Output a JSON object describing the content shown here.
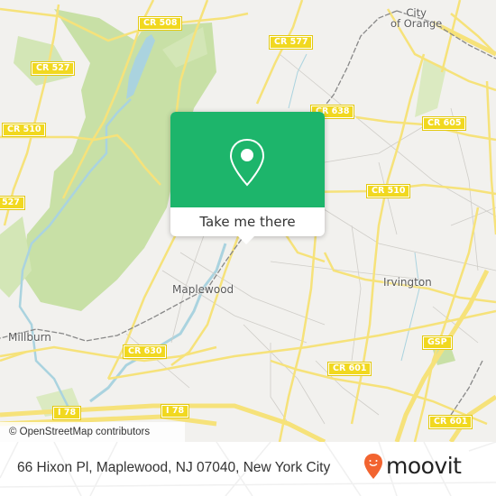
{
  "map": {
    "road_labels": [
      {
        "id": "cr508",
        "text": "CR 508"
      },
      {
        "id": "cr527a",
        "text": "CR 527"
      },
      {
        "id": "cr510a",
        "text": "CR 510"
      },
      {
        "id": "cr527b",
        "text": "527"
      },
      {
        "id": "cr577",
        "text": "CR 577"
      },
      {
        "id": "cr638",
        "text": "CR 638"
      },
      {
        "id": "cr605",
        "text": "CR 605"
      },
      {
        "id": "cr510b",
        "text": "CR 510"
      },
      {
        "id": "cr630",
        "text": "CR 630"
      },
      {
        "id": "i78a",
        "text": "I 78"
      },
      {
        "id": "i78b",
        "text": "I 78"
      },
      {
        "id": "cr601a",
        "text": "CR 601"
      },
      {
        "id": "gsp",
        "text": "GSP"
      },
      {
        "id": "cr601b",
        "text": "CR 601"
      }
    ],
    "places": {
      "city_of_orange_line1": "City",
      "city_of_orange_line2": "of Orange",
      "maplewood": "Maplewood",
      "irvington": "Irvington",
      "millburn": "Millburn"
    },
    "colors": {
      "land": "#f2f1ee",
      "park": "#c8e0a6",
      "water": "#aad3df",
      "road": "#f6e27a",
      "shield": "#f1d81f"
    }
  },
  "attribution": "© OpenStreetMap contributors",
  "popup": {
    "icon": "map-pin-icon",
    "cta_label": "Take me there",
    "color": "#1db56b"
  },
  "footer": {
    "address": "66 Hixon Pl, Maplewood, NJ 07040, New York City",
    "brand": "moovit",
    "brand_color": "#f26430"
  }
}
